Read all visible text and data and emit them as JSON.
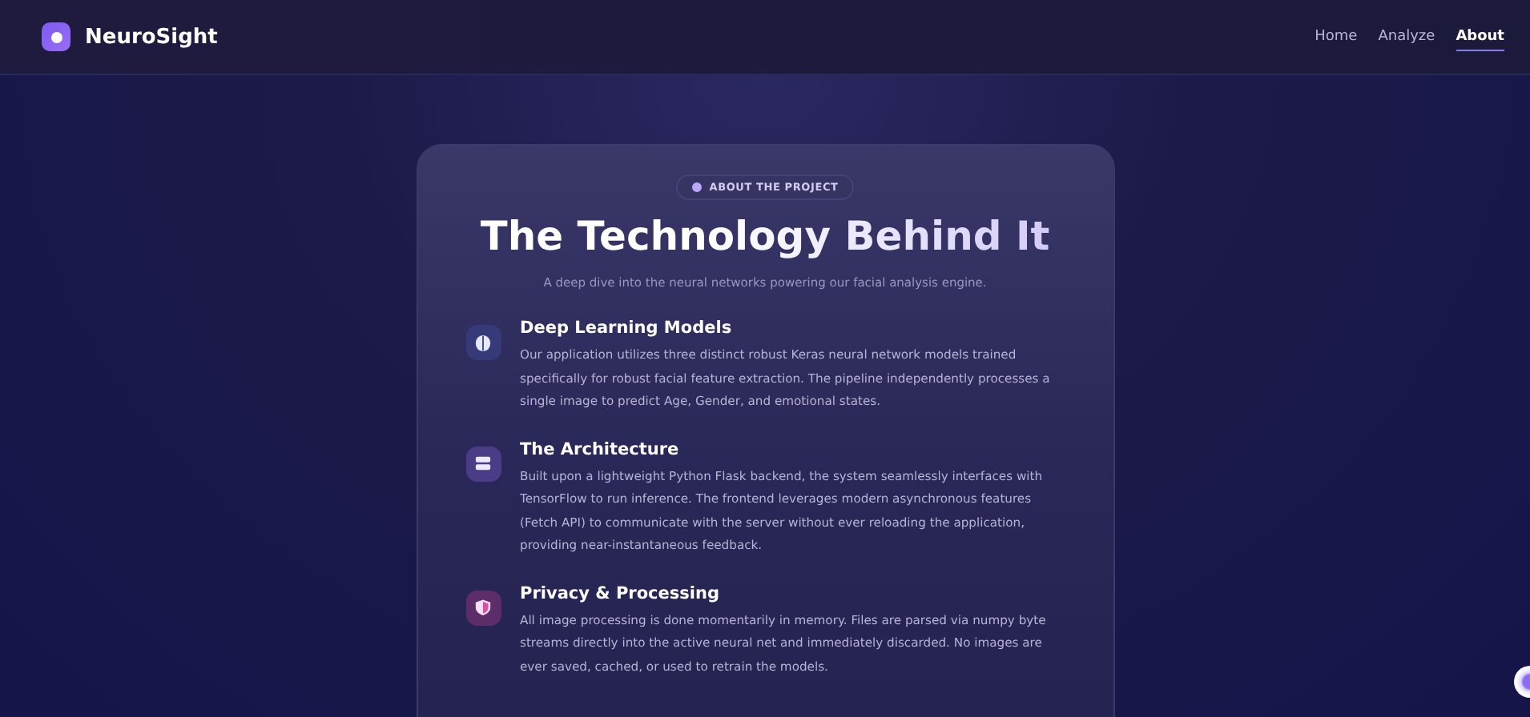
{
  "brand": {
    "name": "NeuroSight"
  },
  "nav": [
    {
      "label": "Home",
      "selected": false
    },
    {
      "label": "Analyze",
      "selected": false
    },
    {
      "label": "About",
      "selected": true
    }
  ],
  "hero": {
    "badge": "ABOUT THE PROJECT",
    "title": "The Technology Behind It",
    "subtitle": "A deep dive into the neural networks powering our facial analysis engine."
  },
  "features": [
    {
      "kind": "brain",
      "color": "#363a78",
      "title": "Deep Learning Models",
      "body": "Our application utilizes three distinct robust Keras neural network models trained specifically for robust facial feature extraction. The pipeline independently processes a single image to predict Age, Gender, and emotional states."
    },
    {
      "kind": "stack",
      "color": "#4a3c86",
      "title": "The Architecture",
      "body": "Built upon a lightweight Python Flask backend, the system seamlessly interfaces with TensorFlow to run inference. The frontend leverages modern asynchronous features (Fetch API) to communicate with the server without ever reloading the application, providing near-instantaneous feedback."
    },
    {
      "kind": "shield",
      "color": "#5c2d68",
      "title": "Privacy & Processing",
      "body": "All image processing is done momentarily in memory. Files are parsed via numpy byte streams directly into the active neural net and immediately discarded. No images are ever saved, cached, or used to retrain the models."
    }
  ]
}
